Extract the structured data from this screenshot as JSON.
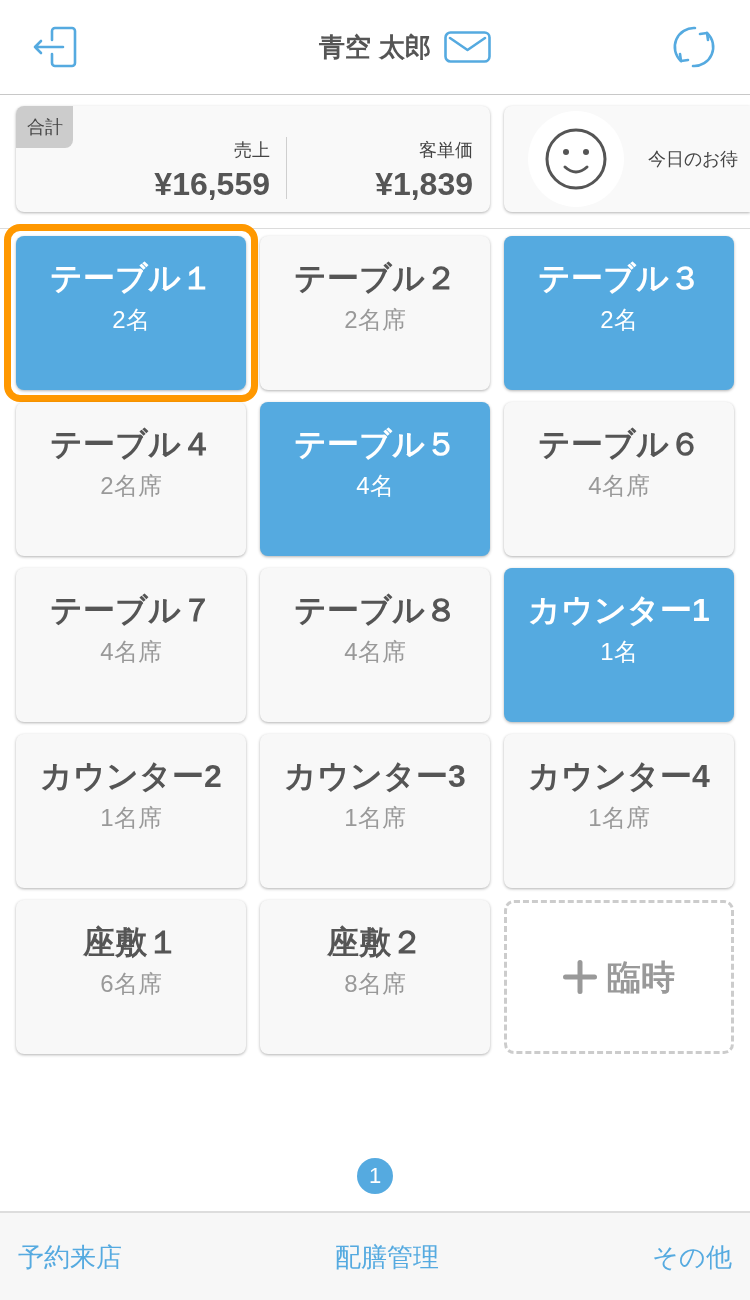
{
  "header": {
    "title": "青空 太郎"
  },
  "summary": {
    "badge": "合計",
    "metrics": [
      {
        "label": "売上",
        "value": "¥16,559"
      },
      {
        "label": "客単価",
        "value": "¥1,839"
      }
    ]
  },
  "waiting_card": {
    "text": "今日のお待"
  },
  "tables": [
    {
      "name": "テーブル１",
      "guests": "2名",
      "occupied": true,
      "selected": true
    },
    {
      "name": "テーブル２",
      "guests": "2名席",
      "occupied": false,
      "selected": false
    },
    {
      "name": "テーブル３",
      "guests": "2名",
      "occupied": true,
      "selected": false
    },
    {
      "name": "テーブル４",
      "guests": "2名席",
      "occupied": false,
      "selected": false
    },
    {
      "name": "テーブル５",
      "guests": "4名",
      "occupied": true,
      "selected": false
    },
    {
      "name": "テーブル６",
      "guests": "4名席",
      "occupied": false,
      "selected": false
    },
    {
      "name": "テーブル７",
      "guests": "4名席",
      "occupied": false,
      "selected": false
    },
    {
      "name": "テーブル８",
      "guests": "4名席",
      "occupied": false,
      "selected": false
    },
    {
      "name": "カウンター1",
      "guests": "1名",
      "occupied": true,
      "selected": false
    },
    {
      "name": "カウンター2",
      "guests": "1名席",
      "occupied": false,
      "selected": false
    },
    {
      "name": "カウンター3",
      "guests": "1名席",
      "occupied": false,
      "selected": false
    },
    {
      "name": "カウンター4",
      "guests": "1名席",
      "occupied": false,
      "selected": false
    },
    {
      "name": "座敷１",
      "guests": "6名席",
      "occupied": false,
      "selected": false
    },
    {
      "name": "座敷２",
      "guests": "8名席",
      "occupied": false,
      "selected": false
    }
  ],
  "temp_tile": {
    "label": "臨時"
  },
  "pager": {
    "pages": [
      {
        "label": "1",
        "selected": true
      }
    ]
  },
  "tab_bar": {
    "items": [
      {
        "label": "予約来店"
      },
      {
        "label": "配膳管理"
      },
      {
        "label": "その他"
      }
    ]
  }
}
